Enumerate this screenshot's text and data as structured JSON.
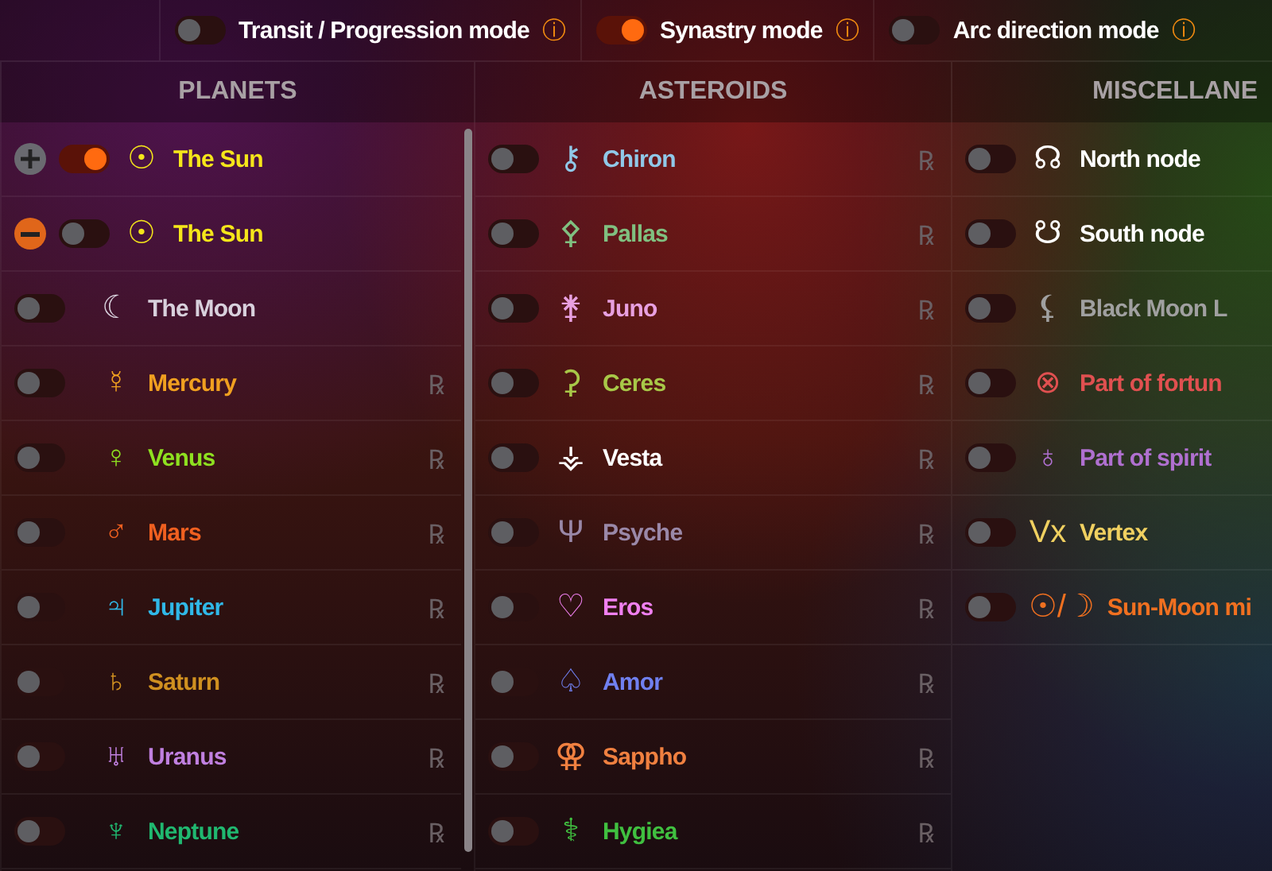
{
  "modes": [
    {
      "label": "Transit / Progression mode",
      "on": false,
      "info": "ⓘ"
    },
    {
      "label": "Synastry mode",
      "on": true,
      "info": "ⓘ"
    },
    {
      "label": "Arc direction mode",
      "on": false,
      "info": "ⓘ"
    }
  ],
  "columns": [
    {
      "title": "PLANETS",
      "items": [
        {
          "kind": "add",
          "on": true,
          "symbol": "☉",
          "name": "The Sun",
          "color": "#f5e61a"
        },
        {
          "kind": "remove",
          "on": false,
          "symbol": "☉",
          "name": "The Sun",
          "color": "#f5e61a"
        },
        {
          "kind": "plain",
          "on": false,
          "symbol": "☾",
          "name": "The Moon",
          "color": "#d8d0dc"
        },
        {
          "kind": "plain",
          "on": false,
          "symbol": "☿",
          "name": "Mercury",
          "color": "#f0a020",
          "retrograde": "℞"
        },
        {
          "kind": "plain",
          "on": false,
          "symbol": "♀",
          "name": "Venus",
          "color": "#8ee020",
          "retrograde": "℞"
        },
        {
          "kind": "plain",
          "on": false,
          "symbol": "♂",
          "name": "Mars",
          "color": "#f06020",
          "retrograde": "℞"
        },
        {
          "kind": "plain",
          "on": false,
          "symbol": "♃",
          "name": "Jupiter",
          "color": "#30b8e8",
          "retrograde": "℞"
        },
        {
          "kind": "plain",
          "on": false,
          "symbol": "♄",
          "name": "Saturn",
          "color": "#d09020",
          "retrograde": "℞"
        },
        {
          "kind": "plain",
          "on": false,
          "symbol": "♅",
          "name": "Uranus",
          "color": "#c080e0",
          "retrograde": "℞"
        },
        {
          "kind": "plain",
          "on": false,
          "symbol": "♆",
          "name": "Neptune",
          "color": "#20b870",
          "retrograde": "℞"
        }
      ]
    },
    {
      "title": "ASTEROIDS",
      "items": [
        {
          "kind": "plain",
          "on": false,
          "symbol": "⚷",
          "name": "Chiron",
          "color": "#90c8e8",
          "retrograde": "℞"
        },
        {
          "kind": "plain",
          "on": false,
          "symbol": "⚴",
          "name": "Pallas",
          "color": "#80c080",
          "retrograde": "℞"
        },
        {
          "kind": "plain",
          "on": false,
          "symbol": "⚵",
          "name": "Juno",
          "color": "#e8a0e0",
          "retrograde": "℞"
        },
        {
          "kind": "plain",
          "on": false,
          "symbol": "⚳",
          "name": "Ceres",
          "color": "#a8c848",
          "retrograde": "℞"
        },
        {
          "kind": "plain",
          "on": false,
          "symbol": "⚶",
          "name": "Vesta",
          "color": "#ffffff",
          "retrograde": "℞"
        },
        {
          "kind": "plain",
          "on": false,
          "symbol": "Ψ",
          "name": "Psyche",
          "color": "#9a88a8",
          "retrograde": "℞"
        },
        {
          "kind": "plain",
          "on": false,
          "symbol": "♡",
          "name": "Eros",
          "color": "#f080f0",
          "retrograde": "℞"
        },
        {
          "kind": "plain",
          "on": false,
          "symbol": "♤",
          "name": "Amor",
          "color": "#7080f0",
          "retrograde": "℞"
        },
        {
          "kind": "plain",
          "on": false,
          "symbol": "⚢",
          "name": "Sappho",
          "color": "#f08040",
          "retrograde": "℞"
        },
        {
          "kind": "plain",
          "on": false,
          "symbol": "⚕",
          "name": "Hygiea",
          "color": "#40c040",
          "retrograde": "℞"
        }
      ]
    },
    {
      "title": "MISCELLANE",
      "items": [
        {
          "kind": "plain",
          "on": false,
          "symbol": "☊",
          "name": "North node",
          "color": "#ffffff"
        },
        {
          "kind": "plain",
          "on": false,
          "symbol": "☋",
          "name": "South node",
          "color": "#ffffff"
        },
        {
          "kind": "plain",
          "on": false,
          "symbol": "⚸",
          "name": "Black Moon L",
          "color": "#a0a0a0"
        },
        {
          "kind": "plain",
          "on": false,
          "symbol": "⊗",
          "name": "Part of fortun",
          "color": "#e05050"
        },
        {
          "kind": "plain",
          "on": false,
          "symbol": "♁",
          "name": "Part of spirit",
          "color": "#b070d0"
        },
        {
          "kind": "plain",
          "on": false,
          "symbol": "Vx",
          "name": "Vertex",
          "color": "#f0d060"
        },
        {
          "kind": "plain",
          "on": false,
          "symbol": "☉/☽",
          "name": "Sun-Moon mi",
          "color": "#f07020"
        }
      ]
    }
  ]
}
